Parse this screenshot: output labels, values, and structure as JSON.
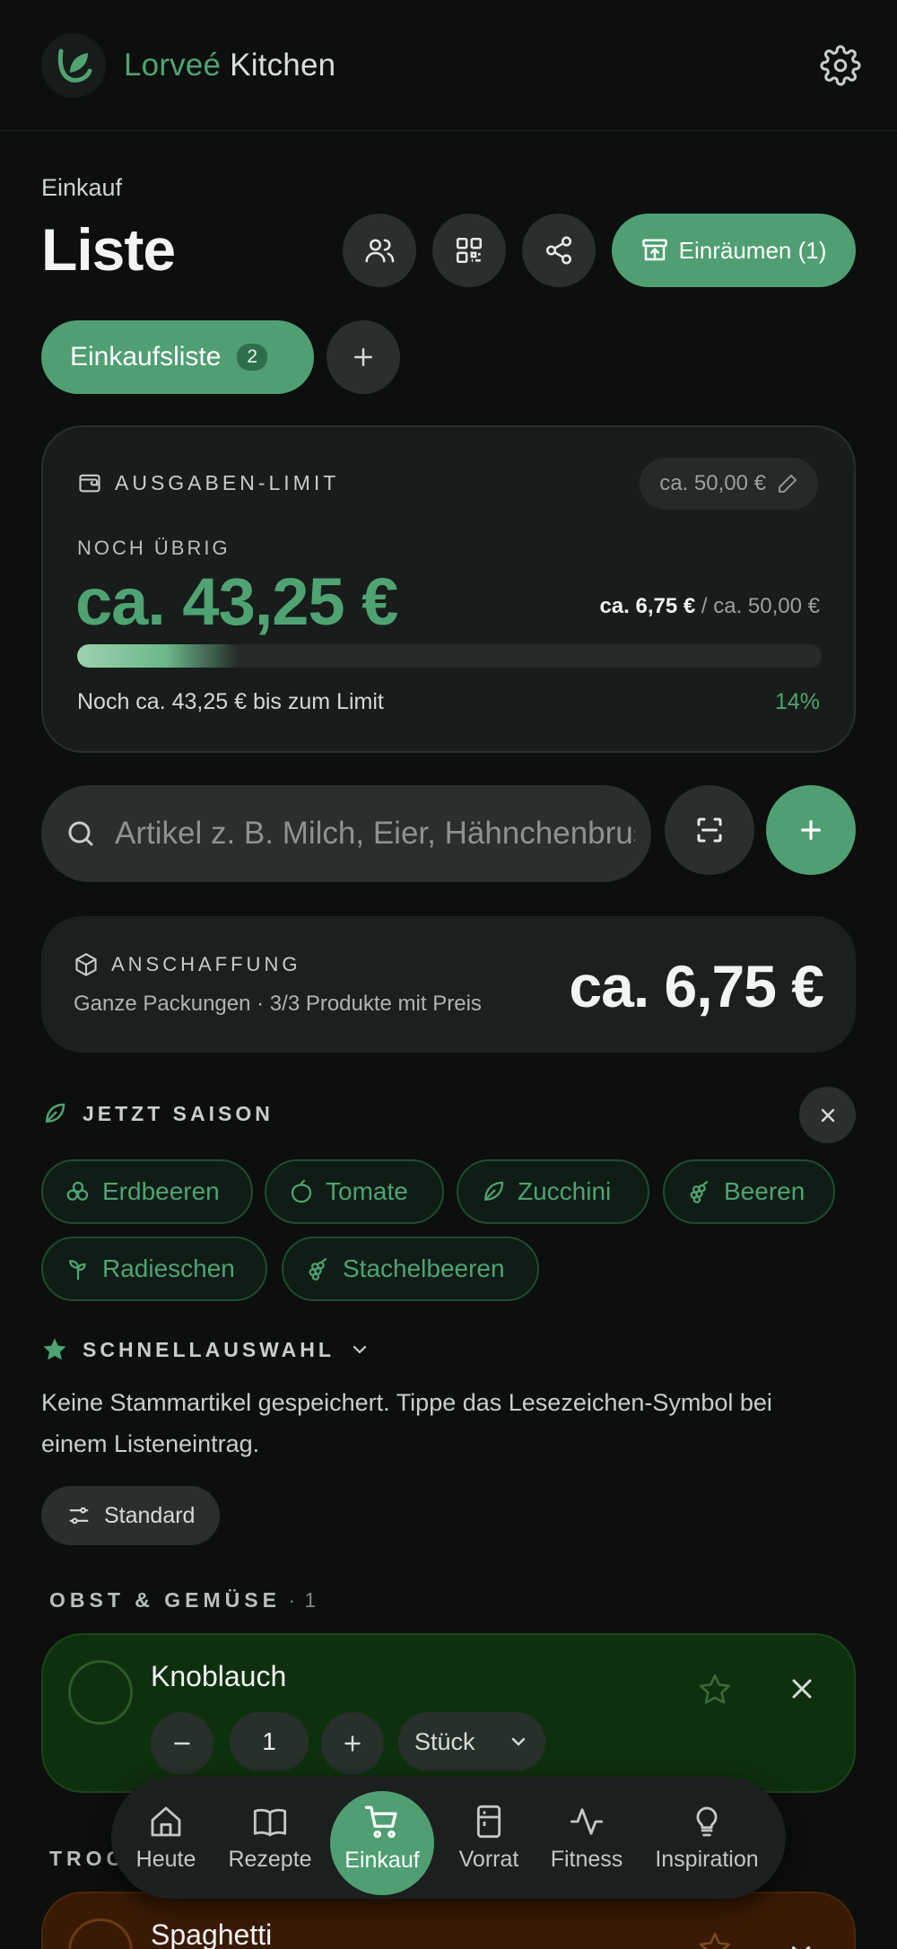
{
  "header": {
    "brand_accent": "Lorveé",
    "brand_rest": "Kitchen"
  },
  "page": {
    "breadcrumb": "Einkauf",
    "title": "Liste",
    "stash_button": "Einräumen (1)"
  },
  "lists": {
    "active_tab": "Einkaufsliste",
    "active_count": "2"
  },
  "budget": {
    "heading": "AUSGABEN-LIMIT",
    "limit_pill": "ca. 50,00 €",
    "remaining_label": "NOCH ÜBRIG",
    "remaining_value": "ca. 43,25 €",
    "spent": "ca. 6,75 €",
    "separator": " / ",
    "limit": "ca. 50,00 €",
    "note": "Noch ca. 43,25 € bis zum Limit",
    "percent_label": "14%",
    "progress": 0.14
  },
  "search": {
    "placeholder": "Artikel z. B. Milch, Eier, Hähnchenbrust"
  },
  "acquisition": {
    "heading": "ANSCHAFFUNG",
    "subtitle": "Ganze Packungen · 3/3 Produkte mit Preis",
    "total": "ca. 6,75 €"
  },
  "season": {
    "heading": "JETZT SAISON",
    "chips": [
      {
        "label": "Erdbeeren",
        "icon": "strawberry-icon"
      },
      {
        "label": "Tomate",
        "icon": "tomato-icon"
      },
      {
        "label": "Zucchini",
        "icon": "leaf-icon"
      },
      {
        "label": "Beeren",
        "icon": "grapes-icon"
      },
      {
        "label": "Radieschen",
        "icon": "sprout-icon"
      },
      {
        "label": "Stachelbeeren",
        "icon": "grapes-icon"
      }
    ]
  },
  "quick": {
    "heading": "SCHNELLAUSWAHL",
    "empty_text": "Keine Stammartikel gespeichert. Tippe das Lesezeichen-Symbol bei einem Listeneintrag.",
    "preset_button": "Standard"
  },
  "categories": [
    {
      "name": "OBST & GEMÜSE",
      "count": " · 1",
      "items": [
        {
          "name": "Knoblauch",
          "quantity": "1",
          "unit": "Stück"
        }
      ]
    },
    {
      "name": "TROC",
      "items": [
        {
          "name": "Spaghetti"
        }
      ]
    }
  ],
  "nav": {
    "items": [
      "Heute",
      "Rezepte",
      "Einkauf",
      "Vorrat",
      "Fitness",
      "Inspiration"
    ],
    "active": "Einkauf"
  },
  "colors": {
    "accent": "#4f9f72",
    "background": "#0c0f0e",
    "card": "#181d1b",
    "produce_card": "#0f300e",
    "dry_goods_card": "#3a1a05"
  }
}
